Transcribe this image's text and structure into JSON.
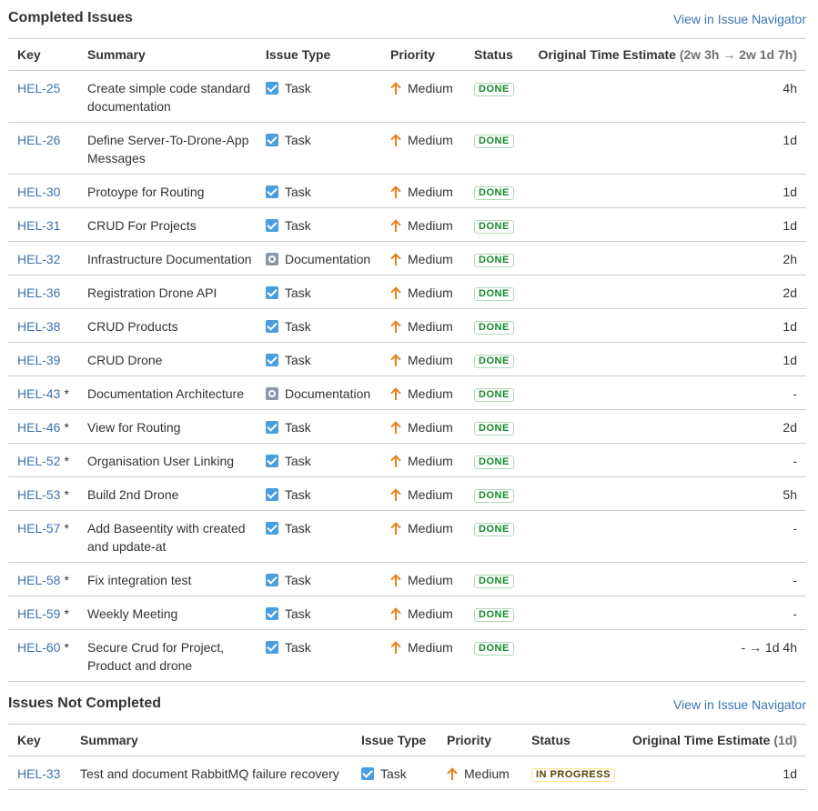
{
  "completed": {
    "title": "Completed Issues",
    "navigator_link": "View in Issue Navigator",
    "columns": {
      "key": "Key",
      "summary": "Summary",
      "type": "Issue Type",
      "priority": "Priority",
      "status": "Status",
      "estimate": "Original Time Estimate",
      "estimate_summary": "(2w 3h → 2w 1d 7h)"
    },
    "rows": [
      {
        "key": "HEL-25",
        "star": "",
        "summary": "Create simple code standard documentation",
        "type": "Task",
        "icon": "task-icon",
        "priority": "Medium",
        "status": "DONE",
        "estimate": "4h"
      },
      {
        "key": "HEL-26",
        "star": "",
        "summary": "Define Server-To-Drone-App Messages",
        "type": "Task",
        "icon": "task-icon",
        "priority": "Medium",
        "status": "DONE",
        "estimate": "1d"
      },
      {
        "key": "HEL-30",
        "star": "",
        "summary": "Protoype for Routing",
        "type": "Task",
        "icon": "task-icon",
        "priority": "Medium",
        "status": "DONE",
        "estimate": "1d"
      },
      {
        "key": "HEL-31",
        "star": "",
        "summary": "CRUD For Projects",
        "type": "Task",
        "icon": "task-icon",
        "priority": "Medium",
        "status": "DONE",
        "estimate": "1d"
      },
      {
        "key": "HEL-32",
        "star": "",
        "summary": "Infrastructure Documentation",
        "type": "Documentation",
        "icon": "documentation-icon",
        "priority": "Medium",
        "status": "DONE",
        "estimate": "2h"
      },
      {
        "key": "HEL-36",
        "star": "",
        "summary": "Registration Drone API",
        "type": "Task",
        "icon": "task-icon",
        "priority": "Medium",
        "status": "DONE",
        "estimate": "2d"
      },
      {
        "key": "HEL-38",
        "star": "",
        "summary": "CRUD Products",
        "type": "Task",
        "icon": "task-icon",
        "priority": "Medium",
        "status": "DONE",
        "estimate": "1d"
      },
      {
        "key": "HEL-39",
        "star": "",
        "summary": "CRUD Drone",
        "type": "Task",
        "icon": "task-icon",
        "priority": "Medium",
        "status": "DONE",
        "estimate": "1d"
      },
      {
        "key": "HEL-43",
        "star": "*",
        "summary": "Documentation Architecture",
        "type": "Documentation",
        "icon": "documentation-icon",
        "priority": "Medium",
        "status": "DONE",
        "estimate": "-"
      },
      {
        "key": "HEL-46",
        "star": "*",
        "summary": "View for Routing",
        "type": "Task",
        "icon": "task-icon",
        "priority": "Medium",
        "status": "DONE",
        "estimate": "2d"
      },
      {
        "key": "HEL-52",
        "star": "*",
        "summary": "Organisation User Linking",
        "type": "Task",
        "icon": "task-icon",
        "priority": "Medium",
        "status": "DONE",
        "estimate": "-"
      },
      {
        "key": "HEL-53",
        "star": "*",
        "summary": "Build 2nd Drone",
        "type": "Task",
        "icon": "task-icon",
        "priority": "Medium",
        "status": "DONE",
        "estimate": "5h"
      },
      {
        "key": "HEL-57",
        "star": "*",
        "summary": "Add Baseentity with created and update-at",
        "type": "Task",
        "icon": "task-icon",
        "priority": "Medium",
        "status": "DONE",
        "estimate": "-"
      },
      {
        "key": "HEL-58",
        "star": "*",
        "summary": "Fix integration test",
        "type": "Task",
        "icon": "task-icon",
        "priority": "Medium",
        "status": "DONE",
        "estimate": "-"
      },
      {
        "key": "HEL-59",
        "star": "*",
        "summary": "Weekly Meeting",
        "type": "Task",
        "icon": "task-icon",
        "priority": "Medium",
        "status": "DONE",
        "estimate": "-"
      },
      {
        "key": "HEL-60",
        "star": "*",
        "summary": "Secure Crud for Project, Product and drone",
        "type": "Task",
        "icon": "task-icon",
        "priority": "Medium",
        "status": "DONE",
        "estimate": "- → 1d 4h"
      }
    ]
  },
  "not_completed": {
    "title": "Issues Not Completed",
    "navigator_link": "View in Issue Navigator",
    "columns": {
      "key": "Key",
      "summary": "Summary",
      "type": "Issue Type",
      "priority": "Priority",
      "status": "Status",
      "estimate": "Original Time Estimate",
      "estimate_summary": "(1d)"
    },
    "rows": [
      {
        "key": "HEL-33",
        "star": "",
        "summary": "Test and document RabbitMQ failure recovery",
        "type": "Task",
        "icon": "task-icon",
        "priority": "Medium",
        "status": "IN PROGRESS",
        "estimate": "1d"
      }
    ]
  },
  "colors": {
    "link": "#3b73af",
    "task_icon": "#4a9ee0",
    "documentation_icon": "#8b97a8",
    "priority_medium": "#e88218",
    "status_done": "#14892c",
    "status_in_progress": "#594300",
    "row_border": "#cccccc"
  }
}
